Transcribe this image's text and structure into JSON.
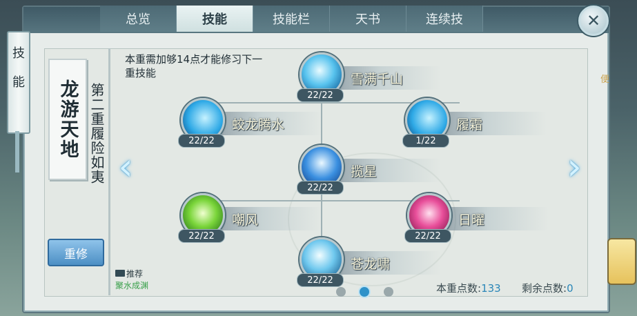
{
  "tabs": [
    {
      "label": "总览",
      "active": false
    },
    {
      "label": "技能",
      "active": true
    },
    {
      "label": "技能栏",
      "active": false
    },
    {
      "label": "天书",
      "active": false
    },
    {
      "label": "连续技",
      "active": false
    }
  ],
  "side_scroll": {
    "chars": [
      "技",
      "能"
    ]
  },
  "school": {
    "name": "龙游天地",
    "tier_label": "第二重履险如夷"
  },
  "tip": "本重需加够14点才能修习下一重技能",
  "reset_button": "重修",
  "recommend": {
    "label": "推荐",
    "sub": "聚水成渊"
  },
  "skills": [
    {
      "name": "雪满千山",
      "level": "22/22",
      "orb": "orb-ice"
    },
    {
      "name": "蛟龙腾水",
      "level": "22/22",
      "orb": "orb-frost"
    },
    {
      "name": "履霜",
      "level": "1/22",
      "orb": "orb-frost"
    },
    {
      "name": "揽星",
      "level": "22/22",
      "orb": "orb-crystal"
    },
    {
      "name": "嘲风",
      "level": "22/22",
      "orb": "orb-green"
    },
    {
      "name": "日曜",
      "level": "22/22",
      "orb": "orb-pink"
    },
    {
      "name": "苍龙啸",
      "level": "22/22",
      "orb": "orb-dragon"
    }
  ],
  "points": {
    "tier_label": "本重点数:",
    "tier_value": "133",
    "remaining_label": "剩余点数:",
    "remaining_value": "0"
  },
  "pager": {
    "pages": 3,
    "current": 2
  },
  "close_label": "✕",
  "arrows": {
    "left": "‹",
    "right": "›"
  },
  "right_edge_text": "便",
  "colors": {
    "active_tab": "#d8e8e8",
    "accent_blue": "#2f92c9",
    "reset_button": "#5d9ed0"
  }
}
